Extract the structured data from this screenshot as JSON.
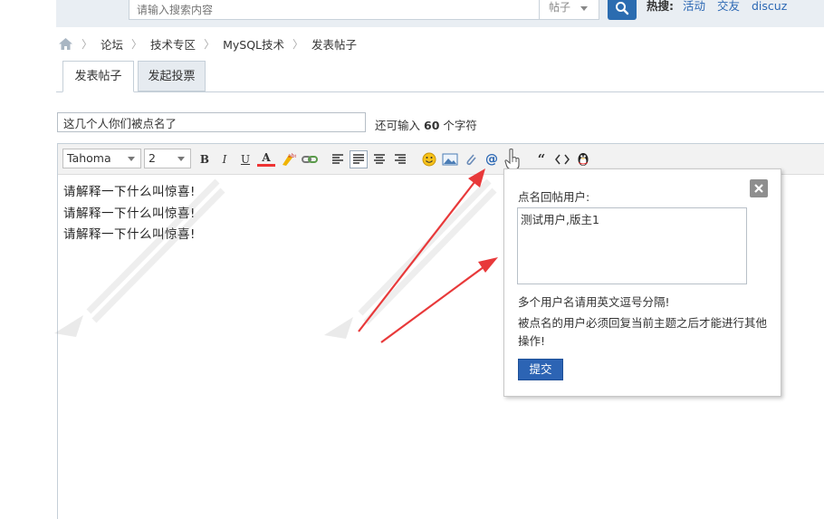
{
  "search": {
    "placeholder": "请输入搜索内容",
    "scope": "帖子",
    "hot_label": "热搜:",
    "hot_links": [
      "活动",
      "交友",
      "discuz"
    ]
  },
  "breadcrumb": {
    "items": [
      "论坛",
      "技术专区",
      "MySQL技术",
      "发表帖子"
    ]
  },
  "tabs": {
    "post": "发表帖子",
    "poll": "发起投票"
  },
  "subject": {
    "value": "这几个人你们被点名了",
    "remain_prefix": "还可输入",
    "remain_count": "60",
    "remain_suffix": "个字符"
  },
  "toolbar": {
    "font_family": "Tahoma",
    "font_size": "2",
    "bold": "B",
    "italic": "I",
    "underline": "U",
    "color": "A",
    "quote": "“"
  },
  "editor": {
    "lines": [
      "请解释一下什么叫惊喜!",
      "请解释一下什么叫惊喜!",
      "请解释一下什么叫惊喜!"
    ]
  },
  "popup": {
    "title": "点名回帖用户:",
    "value": "测试用户,版主1",
    "hint1": "多个用户名请用英文逗号分隔!",
    "hint2": "被点名的用户必须回复当前主题之后才能进行其他操作!",
    "submit": "提交"
  },
  "colors": {
    "accent": "#2c64b4",
    "link": "#2c68b4",
    "arrow": "#e8393a"
  }
}
